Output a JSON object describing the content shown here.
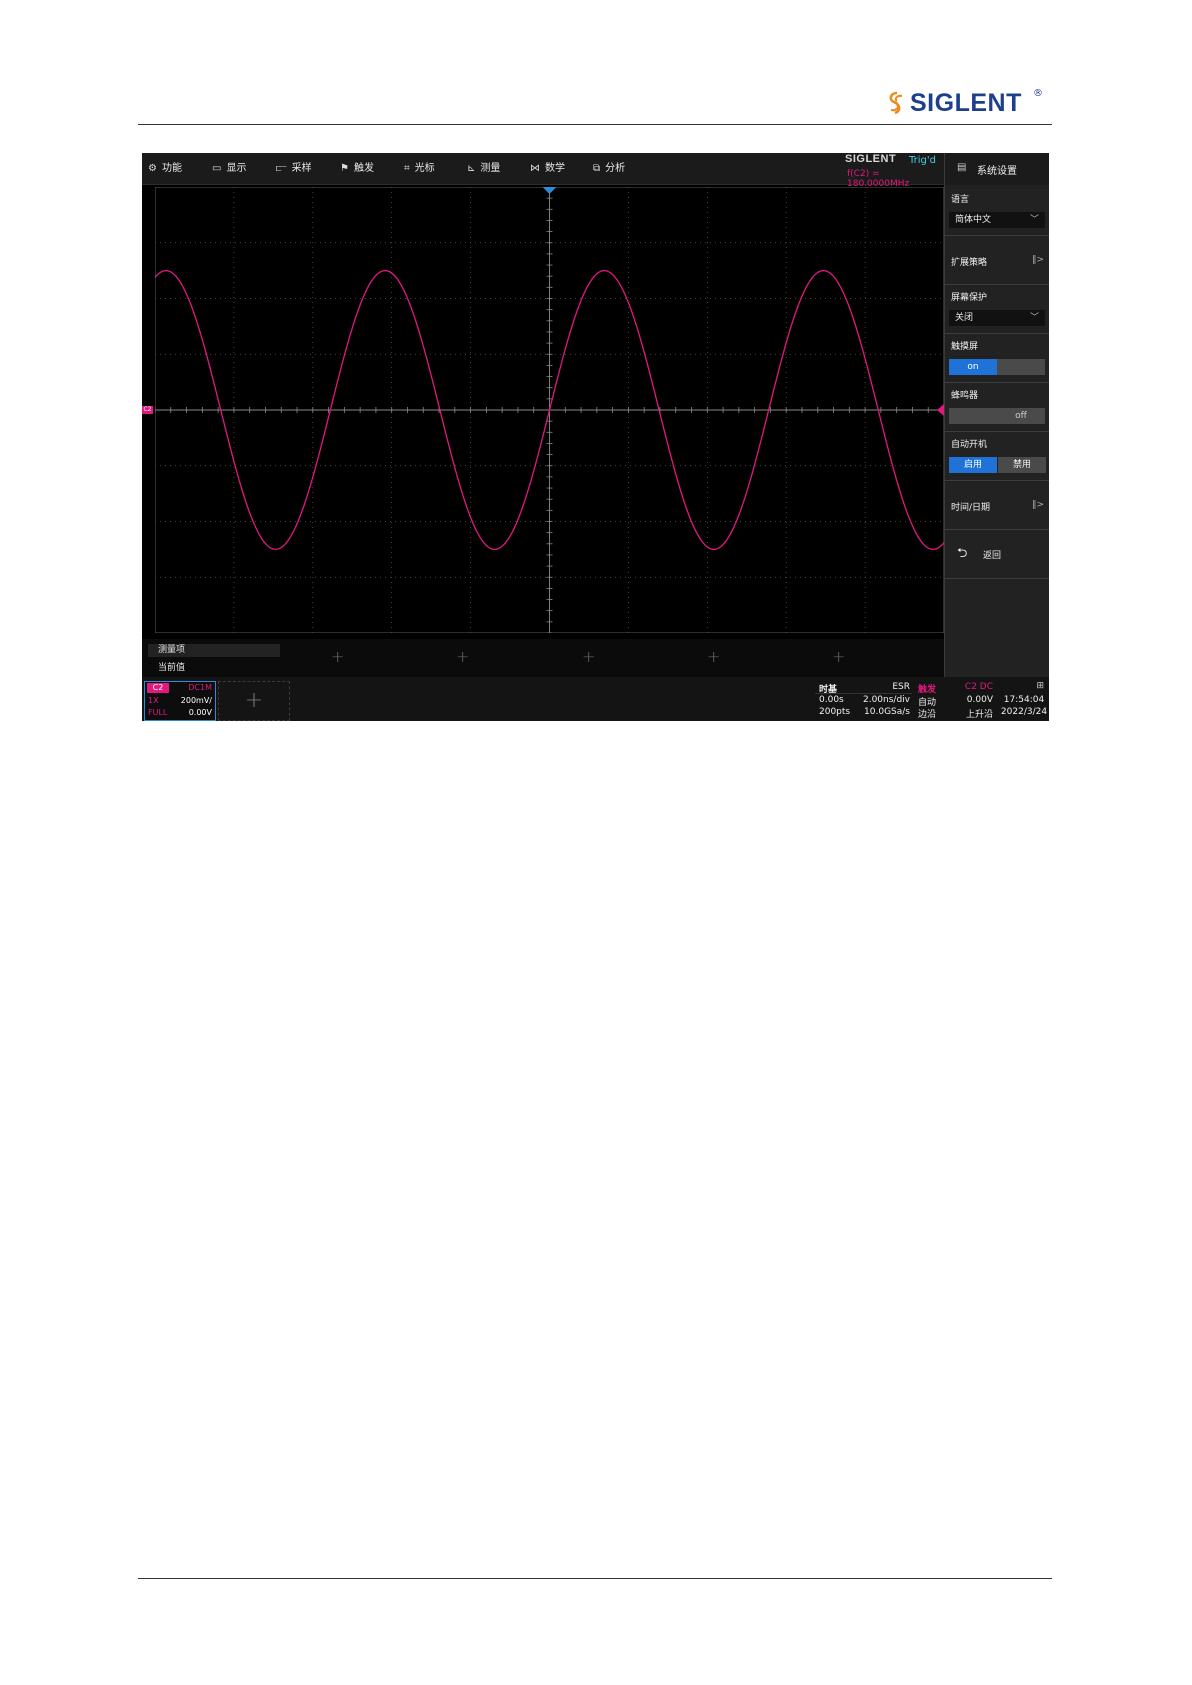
{
  "page": {
    "logo_text": "SIGLENT",
    "logo_reg": "®"
  },
  "menu": {
    "items": [
      {
        "label": "功能",
        "icon": "gear-icon",
        "glyph": "⚙"
      },
      {
        "label": "显示",
        "icon": "monitor-icon",
        "glyph": "▭"
      },
      {
        "label": "采样",
        "icon": "sampling-icon",
        "glyph": "⫍"
      },
      {
        "label": "触发",
        "icon": "flag-icon",
        "glyph": "⚑"
      },
      {
        "label": "光标",
        "icon": "cursor-icon",
        "glyph": "⌗"
      },
      {
        "label": "测量",
        "icon": "measure-icon",
        "glyph": "⊾"
      },
      {
        "label": "数学",
        "icon": "math-icon",
        "glyph": "⋈"
      },
      {
        "label": "分析",
        "icon": "analysis-icon",
        "glyph": "⧉"
      }
    ],
    "brand": "SIGLENT",
    "trigger_state": "Trig'd",
    "frequency_readout": "f(C2) = 180.0000MHz"
  },
  "colors": {
    "channel2": "#e0197f",
    "accent_blue": "#1f73d8",
    "grid": "#5a5a5a"
  },
  "waveform": {
    "channel": "C2",
    "type": "sine",
    "frequency_mhz": 180.0,
    "amplitude_div": 2.5,
    "horizontal_divisions": 10,
    "vertical_divisions": 8,
    "trigger_level_div": 0
  },
  "measure": {
    "item_label": "测量项",
    "value_label": "当前值",
    "plus": "+"
  },
  "channel_box": {
    "name": "C2",
    "coupling": "DC1M",
    "probe": "1X",
    "scale": "200mV/",
    "bandwidth": "FULL",
    "offset": "0.00V"
  },
  "add_channel": "+",
  "timebase": {
    "title": "时基",
    "mode": "ESR",
    "delay": "0.00s",
    "scale": "2.00ns/div",
    "points": "200pts",
    "sample_rate": "10.0GSa/s"
  },
  "trigger": {
    "title": "触发",
    "source": "C2 DC",
    "mode": "自动",
    "level": "0.00V",
    "type": "边沿",
    "slope": "上升沿"
  },
  "clock": {
    "network_icon": "network-icon",
    "time": "17:54:04",
    "date": "2022/3/24"
  },
  "side_panel": {
    "title": "系统设置",
    "language_label": "语言",
    "language_value": "简体中文",
    "expand_strategy": "扩展策略",
    "screensaver_label": "屏幕保护",
    "screensaver_value": "关闭",
    "touch_label": "触摸屏",
    "touch_on": "on",
    "buzzer_label": "蜂鸣器",
    "buzzer_off": "off",
    "auto_power_label": "自动开机",
    "auto_power_enable": "启用",
    "auto_power_disable": "禁用",
    "datetime_label": "时间/日期",
    "back_label": "返回",
    "arrow_glyph": "‖>",
    "chevron_glyph": "﹀",
    "back_glyph": "⮌"
  }
}
